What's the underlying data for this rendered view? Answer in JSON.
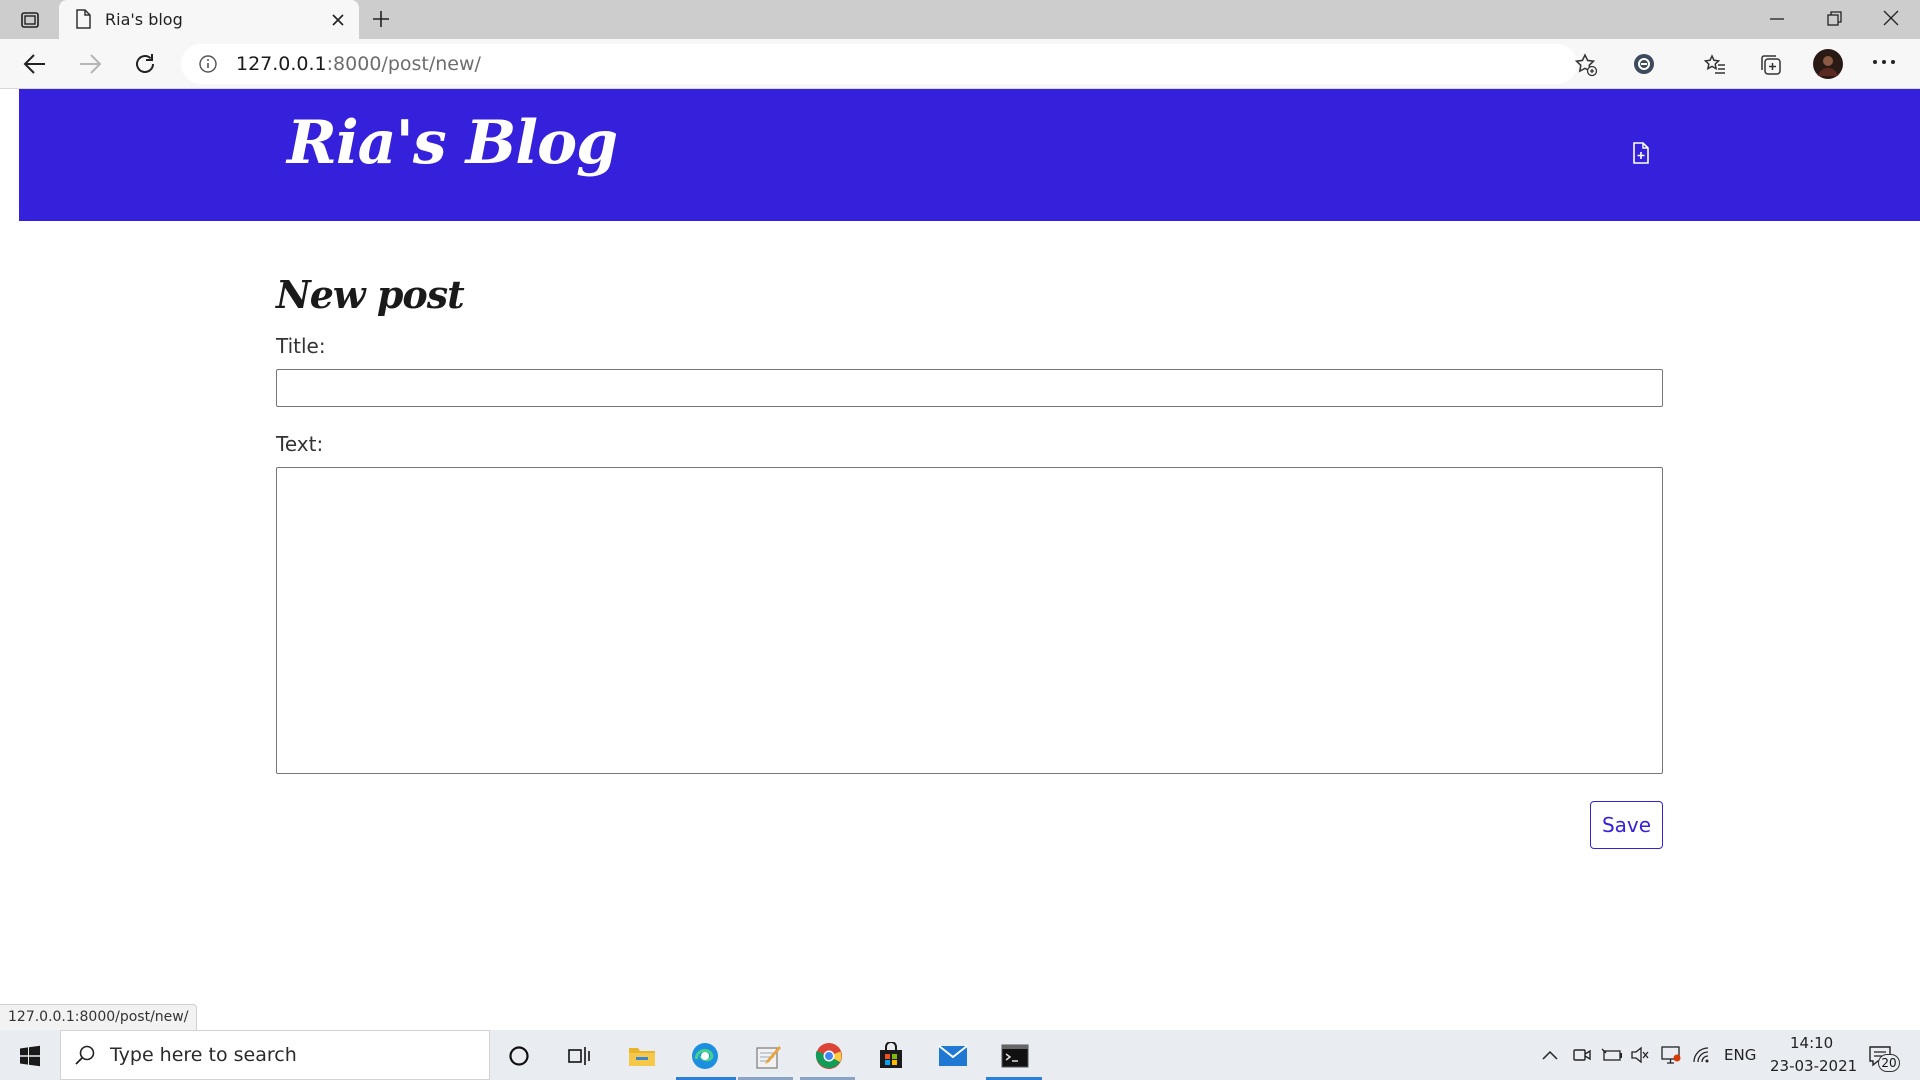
{
  "browser": {
    "tab_title": "Ria's blog",
    "url_host": "127.0.0.1",
    "url_path": ":8000/post/new/",
    "status_url": "127.0.0.1:8000/post/new/"
  },
  "page": {
    "brand": "Ria's Blog",
    "heading": "New post",
    "title_label": "Title:",
    "text_label": "Text:",
    "title_value": "",
    "text_value": "",
    "save_label": "Save"
  },
  "taskbar": {
    "search_placeholder": "Type here to search",
    "language": "ENG",
    "time": "14:10",
    "date": "23-03-2021",
    "notification_count": "20"
  },
  "colors": {
    "accent": "#3520dc",
    "tab_strip": "#cdcdcd"
  }
}
